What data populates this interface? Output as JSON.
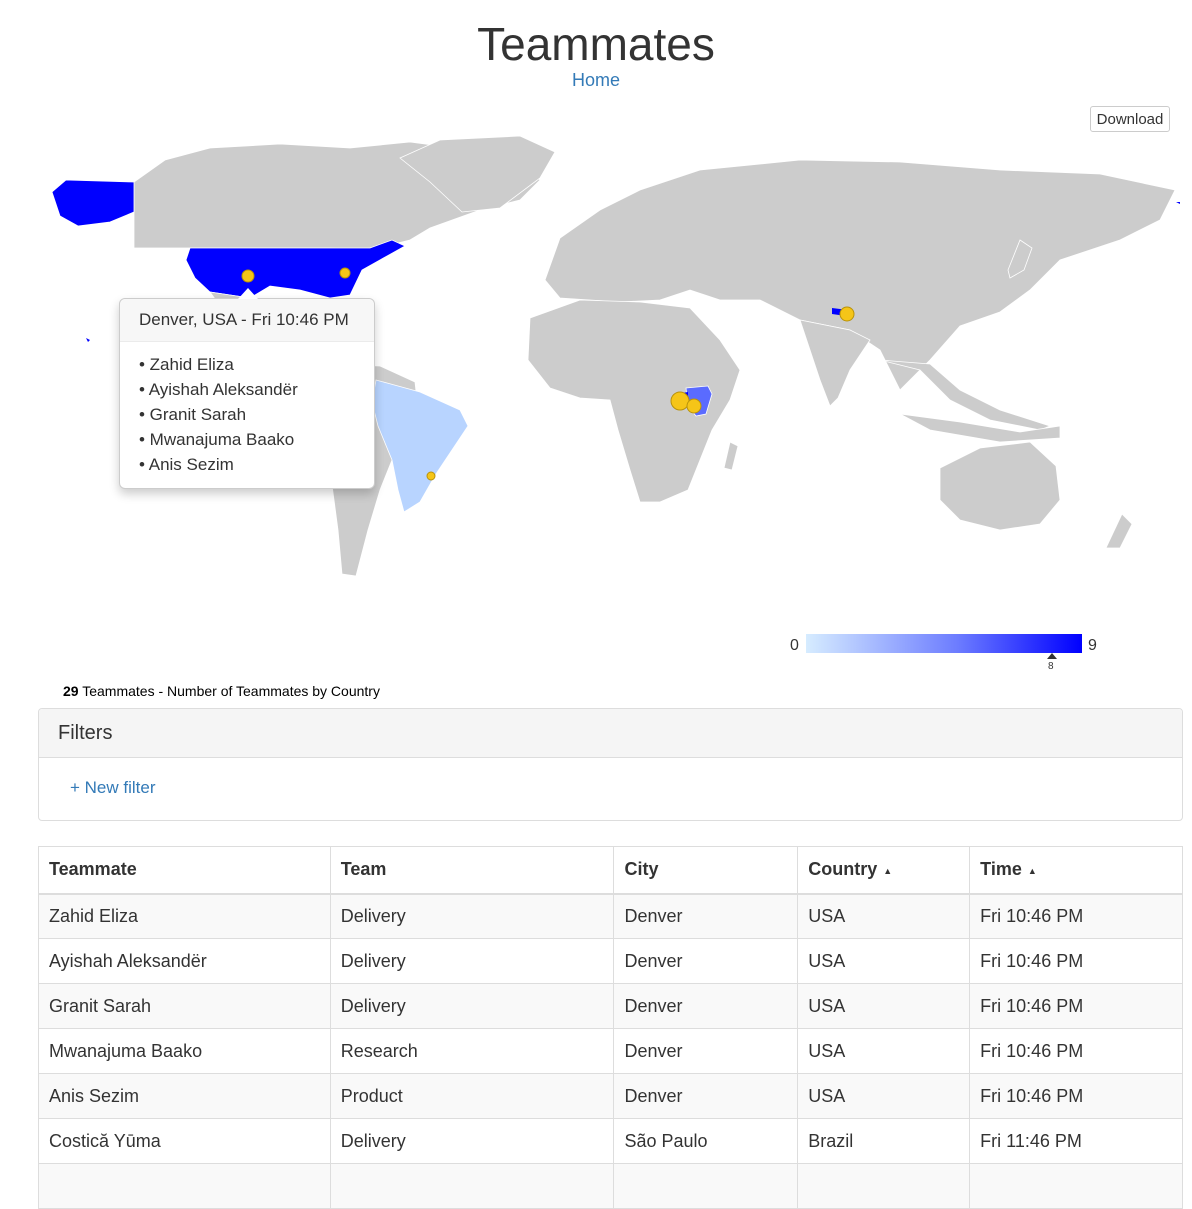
{
  "header": {
    "title": "Teammates",
    "home_link": "Home"
  },
  "toolbar": {
    "download_label": "Download"
  },
  "map": {
    "tooltip": {
      "title": "Denver, USA - Fri 10:46 PM",
      "members": [
        "• Zahid Eliza",
        "• Ayishah Aleksandër",
        "• Granit Sarah",
        "• Mwanajuma Baako",
        "• Anis Sezim"
      ]
    },
    "legend": {
      "min": "0",
      "max": "9",
      "marker": "8"
    },
    "colors": {
      "land": "#cccccc",
      "high": "#0000ff",
      "mid": "#5a6bff",
      "low": "#b8d4ff",
      "marker": "#f5c518"
    },
    "caption": {
      "count": "29",
      "text": " Teammates - Number of Teammates by Country"
    }
  },
  "filters": {
    "title": "Filters",
    "new_filter_label": "+ New filter"
  },
  "table": {
    "headers": {
      "teammate": "Teammate",
      "team": "Team",
      "city": "City",
      "country": "Country",
      "time": "Time"
    },
    "sort_icon": "▲",
    "rows": [
      {
        "teammate": "Zahid Eliza",
        "team": "Delivery",
        "city": "Denver",
        "country": "USA",
        "time": "Fri 10:46 PM"
      },
      {
        "teammate": "Ayishah Aleksandër",
        "team": "Delivery",
        "city": "Denver",
        "country": "USA",
        "time": "Fri 10:46 PM"
      },
      {
        "teammate": "Granit Sarah",
        "team": "Delivery",
        "city": "Denver",
        "country": "USA",
        "time": "Fri 10:46 PM"
      },
      {
        "teammate": "Mwanajuma Baako",
        "team": "Research",
        "city": "Denver",
        "country": "USA",
        "time": "Fri 10:46 PM"
      },
      {
        "teammate": "Anis Sezim",
        "team": "Product",
        "city": "Denver",
        "country": "USA",
        "time": "Fri 10:46 PM"
      },
      {
        "teammate": "Costică Yūma",
        "team": "Delivery",
        "city": "São Paulo",
        "country": "Brazil",
        "time": "Fri 11:46 PM"
      },
      {
        "teammate": "",
        "team": "",
        "city": "",
        "country": "",
        "time": ""
      }
    ]
  }
}
